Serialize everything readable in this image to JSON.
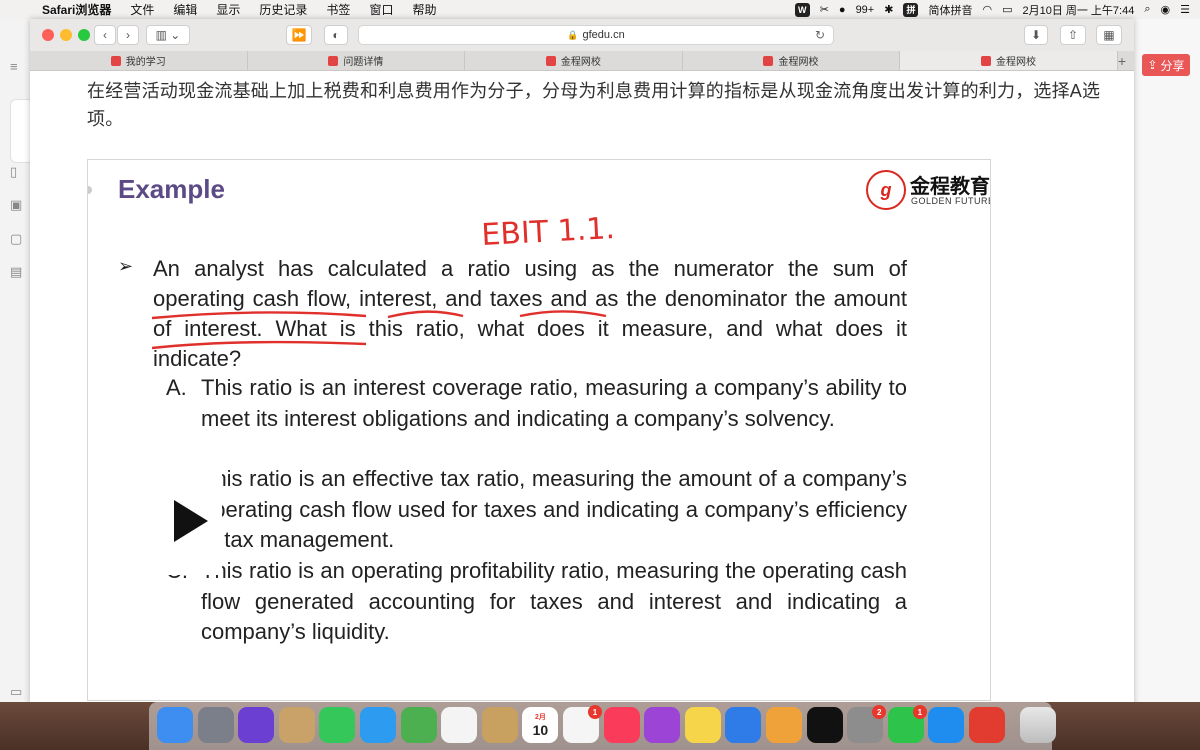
{
  "menubar": {
    "app_name": "Safari浏览器",
    "items": [
      "文件",
      "编辑",
      "显示",
      "历史记录",
      "书签",
      "窗口",
      "帮助"
    ],
    "tray": {
      "notifications": "99+",
      "input_method": "简体拼音",
      "datetime": "2月10日 周一 上午7:44"
    }
  },
  "browser": {
    "address": "gfedu.cn",
    "tabs": [
      {
        "label": "我的学习"
      },
      {
        "label": "问题详情"
      },
      {
        "label": "金程网校"
      },
      {
        "label": "金程网校"
      },
      {
        "label": "金程网校"
      }
    ],
    "active_tab_index": 4
  },
  "side_app": {
    "share_label": "分享"
  },
  "page": {
    "explanation": "在经营活动现金流基础上加上税费和利息费用作为分子，分母为利息费用计算的指标是从现金流角度出发计算的利力，选择A选项。",
    "slide": {
      "title": "Example",
      "logo": {
        "cn": "金程教育",
        "en": "GOLDEN FUTURE"
      },
      "handwritten_note": "EBIT 1.1.",
      "question_parts": {
        "p1": "An analyst has calculated a ratio using as the numerator the sum of ",
        "u1": "operating cash flow",
        "p2": ", ",
        "u2": "interest",
        "p3": ", and ",
        "u3": "taxes ",
        "p4": "and as the denominator the ",
        "u4": "amount of interest.",
        "p5": " What is this ratio, what does it measure, and what does it indicate?"
      },
      "options": [
        {
          "letter": "A.",
          "text": "This ratio is an interest coverage ratio, measuring a company’s ability to meet its interest obligations and indicating a company’s solvency."
        },
        {
          "letter": "B.",
          "text": "This ratio is an effective tax ratio, measuring the amount of a company’s operating cash flow used for taxes and indicating a company’s efficiency in tax management."
        },
        {
          "letter": "C.",
          "text": "This ratio is an operating profitability ratio, measuring the operating cash flow generated accounting for taxes and interest and indicating a company’s liquidity."
        }
      ]
    }
  },
  "dock": {
    "apps": [
      "finder-icon",
      "launchpad-icon",
      "siri-icon",
      "preview-icon",
      "facetime-icon",
      "messages-icon",
      "maps-icon",
      "photos-icon",
      "contacts-icon",
      "calendar-icon",
      "reminders-icon",
      "music-icon",
      "podcasts-icon",
      "notes-icon",
      "keynote-icon",
      "pages-icon",
      "apple-tv-icon",
      "system-preferences-icon",
      "wechat-icon",
      "safari-icon",
      "wps-icon",
      "trash-icon"
    ],
    "calendar_date": "10",
    "calendar_month": "2月",
    "badges": {
      "reminders": "1",
      "system_preferences": "2",
      "wechat": "1"
    }
  }
}
